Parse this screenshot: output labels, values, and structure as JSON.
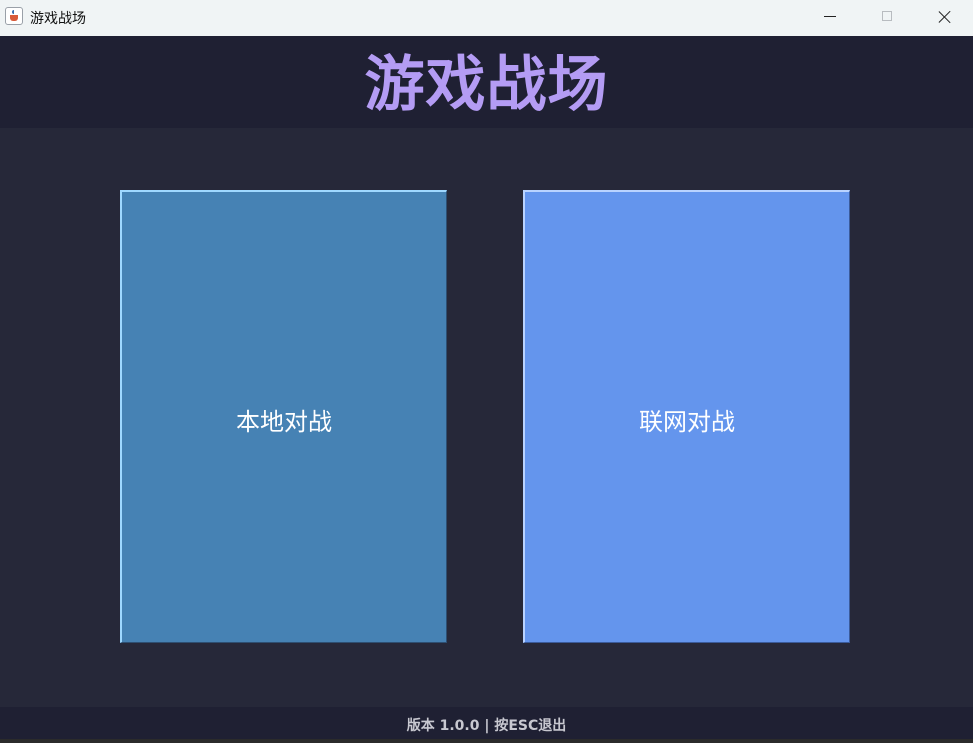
{
  "window": {
    "title": "游戏战场",
    "icon": "java-app-icon"
  },
  "header": {
    "title": "游戏战场"
  },
  "main": {
    "buttons": [
      {
        "label": "本地对战",
        "color": "#4682b4"
      },
      {
        "label": "联网对战",
        "color": "#6495ed"
      }
    ]
  },
  "footer": {
    "text": "版本 1.0.0 | 按ESC退出"
  },
  "colors": {
    "header_bg": "#1f2033",
    "main_bg": "#262839",
    "title_accent": "#b49cf4"
  }
}
